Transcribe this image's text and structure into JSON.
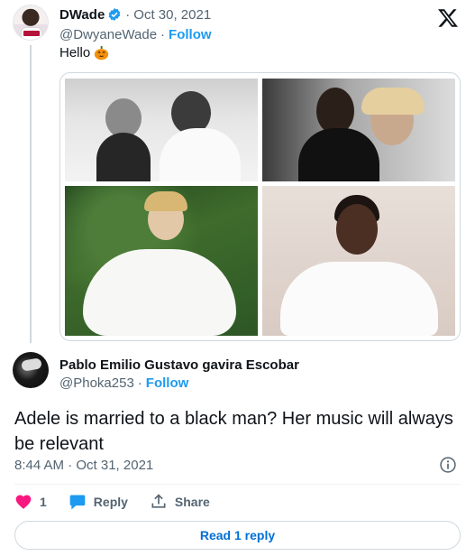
{
  "parent_tweet": {
    "display_name": "DWade",
    "date": "Oct 30, 2021",
    "handle": "@DwyaneWade",
    "follow_label": "Follow",
    "text": "Hello",
    "emoji": "jack-o-lantern",
    "separator": "·"
  },
  "reply_tweet": {
    "display_name": "Pablo Emilio Gustavo gavira Escobar",
    "handle": "@Phoka253",
    "follow_label": "Follow",
    "separator": "·",
    "text": "Adele is married to a black man? Her music will always be relevant",
    "timestamp": "8:44 AM · Oct 31, 2021"
  },
  "actions": {
    "like_count": "1",
    "reply_label": "Reply",
    "share_label": "Share"
  },
  "read_replies_label": "Read 1 reply",
  "colors": {
    "accent": "#1d9bf0",
    "like": "#f91880",
    "text": "#0f1419",
    "secondary": "#536471",
    "border": "#cfd9de"
  },
  "icons": [
    "verified-badge-icon",
    "x-logo-icon",
    "pumpkin-icon",
    "info-icon",
    "heart-icon",
    "reply-bubble-icon",
    "share-icon"
  ]
}
